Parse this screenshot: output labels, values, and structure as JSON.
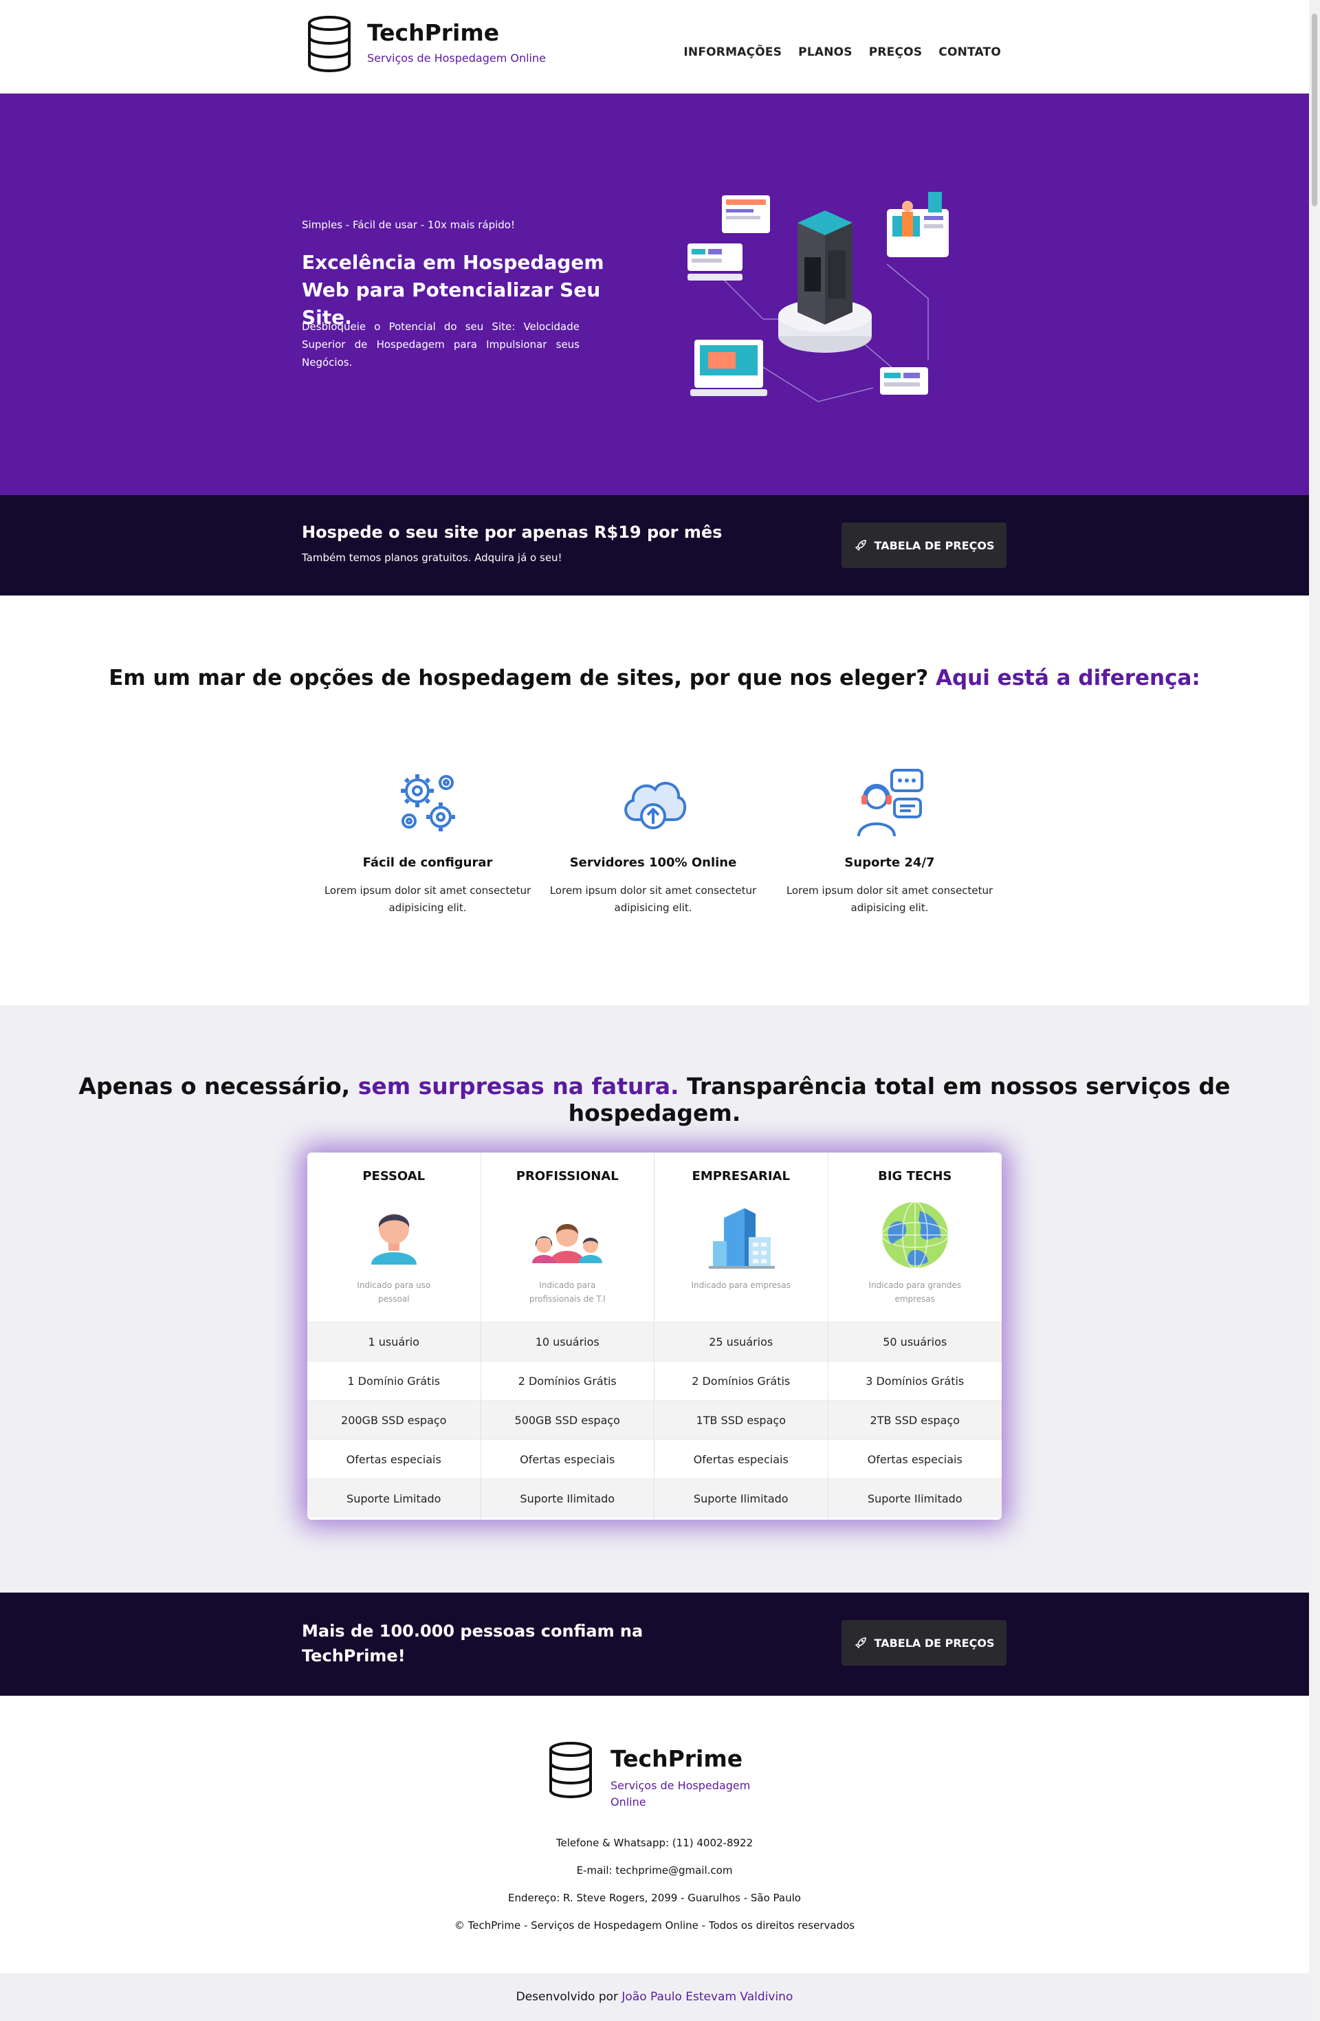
{
  "header": {
    "brand": "TechPrime",
    "tagline": "Serviços de Hospedagem Online",
    "nav": [
      "INFORMAÇÕES",
      "PLANOS",
      "PREÇOS",
      "CONTATO"
    ]
  },
  "hero": {
    "tag": "Simples - Fácil de usar - 10x mais rápido!",
    "title": "Excelência em Hospedagem Web para Potencializar Seu Site.",
    "description": "Desbloqueie o Potencial do seu Site: Velocidade Superior de Hospedagem para Impulsionar seus Negócios."
  },
  "cta1": {
    "title": "Hospede o seu site por apenas R$19 por mês",
    "subtitle": "Também temos planos gratuitos. Adquira já o seu!",
    "button": "TABELA DE PREÇOS"
  },
  "difference": {
    "title_main": "Em um mar de opções de hospedagem de sites, por que nos eleger?",
    "title_accent": "Aqui está a diferença:",
    "features": [
      {
        "name": "Fácil de configurar",
        "desc": "Lorem ipsum dolor sit amet consectetur adipisicing elit.",
        "icon": "gears-icon"
      },
      {
        "name": "Servidores 100% Online",
        "desc": "Lorem ipsum dolor sit amet consectetur adipisicing elit.",
        "icon": "cloud-upload-icon"
      },
      {
        "name": "Suporte 24/7",
        "desc": "Lorem ipsum dolor sit amet consectetur adipisicing elit.",
        "icon": "support-agent-icon"
      }
    ]
  },
  "pricing": {
    "title_part1": "Apenas o necessário,",
    "title_accent": "sem surpresas na fatura.",
    "title_part2": "Transparência total em nossos serviços de hospedagem.",
    "plans": [
      {
        "name": "PESSOAL",
        "hint": "Indicado para uso pessoal",
        "icon": "person-icon",
        "features": [
          "1 usuário",
          "1 Domínio Grátis",
          "200GB SSD espaço",
          "Ofertas especiais",
          "Suporte Limitado"
        ]
      },
      {
        "name": "PROFISSIONAL",
        "hint": "Indicado para profissionais de T.I",
        "icon": "team-icon",
        "features": [
          "10 usuários",
          "2 Domínios Grátis",
          "500GB SSD espaço",
          "Ofertas especiais",
          "Suporte Ilimitado"
        ]
      },
      {
        "name": "EMPRESARIAL",
        "hint": "Indicado para empresas",
        "icon": "building-icon",
        "features": [
          "25 usuários",
          "2 Domínios Grátis",
          "1TB SSD espaço",
          "Ofertas especiais",
          "Suporte Ilimitado"
        ]
      },
      {
        "name": "BIG TECHS",
        "hint": "Indicado para grandes empresas",
        "icon": "globe-icon",
        "features": [
          "50 usuários",
          "3 Domínios Grátis",
          "2TB SSD espaço",
          "Ofertas especiais",
          "Suporte Ilimitado"
        ]
      }
    ]
  },
  "cta2": {
    "title": "Mais de 100.000 pessoas confiam na TechPrime!",
    "button": "TABELA DE PREÇOS"
  },
  "footer": {
    "brand": "TechPrime",
    "tagline": "Serviços de Hospedagem Online",
    "phone": "Telefone & Whatsapp: (11) 4002-8922",
    "email": "E-mail: techprime@gmail.com",
    "address": "Endereço: R. Steve Rogers, 2099 - Guarulhos - São Paulo",
    "copyright": "© TechPrime - Serviços de Hospedagem Online - Todos os direitos reservados",
    "dev_prefix": "Desenvolvido por",
    "dev_name": "João Paulo Estevam Valdivino"
  },
  "colors": {
    "primary": "#5b1aa0",
    "dark": "#140a2e",
    "button": "#2a2a2e",
    "section_bg": "#f0f0f4"
  }
}
